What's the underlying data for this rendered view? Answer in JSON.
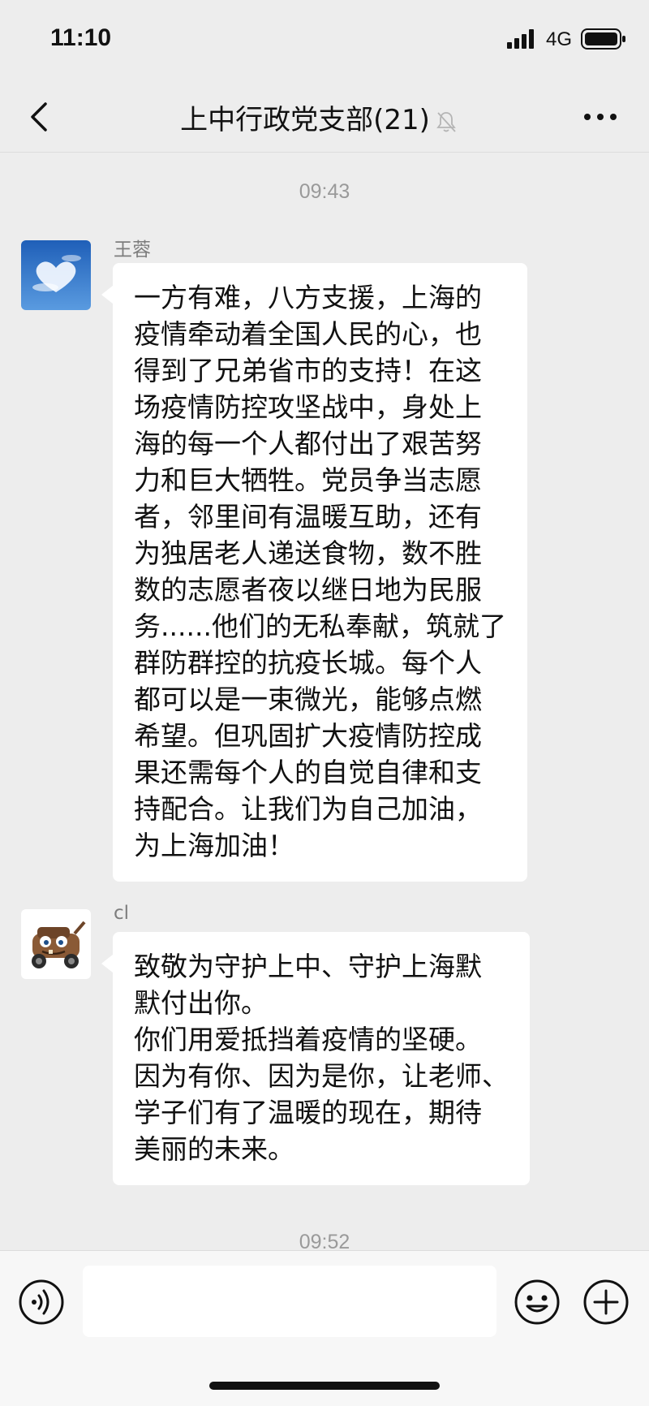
{
  "status_bar": {
    "time": "11:10",
    "network": "4G"
  },
  "nav": {
    "title": "上中行政党支部(21)",
    "back_icon": "chevron-left-icon",
    "mute_icon": "bell-slash-icon",
    "more_icon": "ellipsis-icon"
  },
  "messages": {
    "timestamp_1": "09:43",
    "msg1": {
      "sender": "王蓉",
      "avatar": "sky-heart-cloud-avatar",
      "lines": [
        "一方有难，八方支援，上海的",
        "疫情牵动着全国人民的心，也",
        "得到了兄弟省市的支持！在这",
        "场疫情防控攻坚战中，身处上",
        "海的每一个人都付出了艰苦努",
        "力和巨大牺牲。党员争当志愿",
        "者，邻里间有温暖互助，还有",
        "为独居老人递送食物，数不胜",
        "数的志愿者夜以继日地为民服",
        "务......他们的无私奉献，筑就了",
        "群防群控的抗疫长城。每个人",
        "都可以是一束微光，能够点燃",
        "希望。但巩固扩大疫情防控成",
        "果还需每个人的自觉自律和支",
        "持配合。让我们为自己加油，",
        "为上海加油！"
      ]
    },
    "msg2": {
      "sender": "cl",
      "avatar": "tow-truck-cartoon-avatar",
      "lines": [
        "致敬为守护上中、守护上海默",
        "默付出你。",
        "你们用爱抵挡着疫情的坚硬。",
        "因为有你、因为是你，让老师、",
        "学子们有了温暖的现在，期待",
        "美丽的未来。"
      ]
    },
    "timestamp_2": "09:52"
  },
  "input_bar": {
    "voice_icon": "voice-icon",
    "emoji_icon": "emoji-icon",
    "plus_icon": "plus-icon",
    "text_value": ""
  },
  "colors": {
    "background": "#ededed",
    "bubble": "#ffffff",
    "input_bar": "#f7f7f7"
  }
}
